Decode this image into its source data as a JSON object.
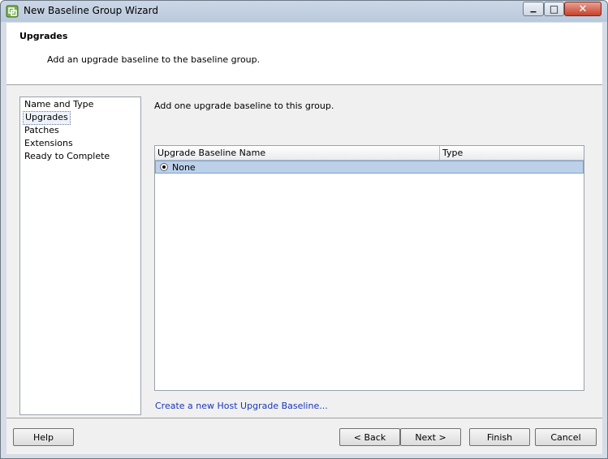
{
  "window": {
    "title": "New Baseline Group Wizard",
    "minimize_glyph": "▁",
    "maximize_glyph": "□",
    "close_glyph": "✕"
  },
  "header": {
    "title": "Upgrades",
    "description": "Add an upgrade baseline to the baseline group."
  },
  "steps": [
    {
      "label": "Name and Type"
    },
    {
      "label": "Upgrades"
    },
    {
      "label": "Patches"
    },
    {
      "label": "Extensions"
    },
    {
      "label": "Ready to Complete"
    }
  ],
  "content": {
    "description": "Add one upgrade baseline to this group.",
    "table": {
      "columns": [
        "Upgrade Baseline Name",
        "Type"
      ],
      "rows": [
        {
          "name": "None",
          "type": "",
          "selected": true
        }
      ]
    },
    "create_link": "Create a new Host Upgrade Baseline..."
  },
  "buttons": {
    "help": "Help",
    "back": "< Back",
    "next": "Next >",
    "finish": "Finish",
    "cancel": "Cancel"
  },
  "icons": {
    "app": "vmware-wizard-icon"
  },
  "colors": {
    "selection": "#bcd0e9",
    "link": "#1a35b8"
  }
}
